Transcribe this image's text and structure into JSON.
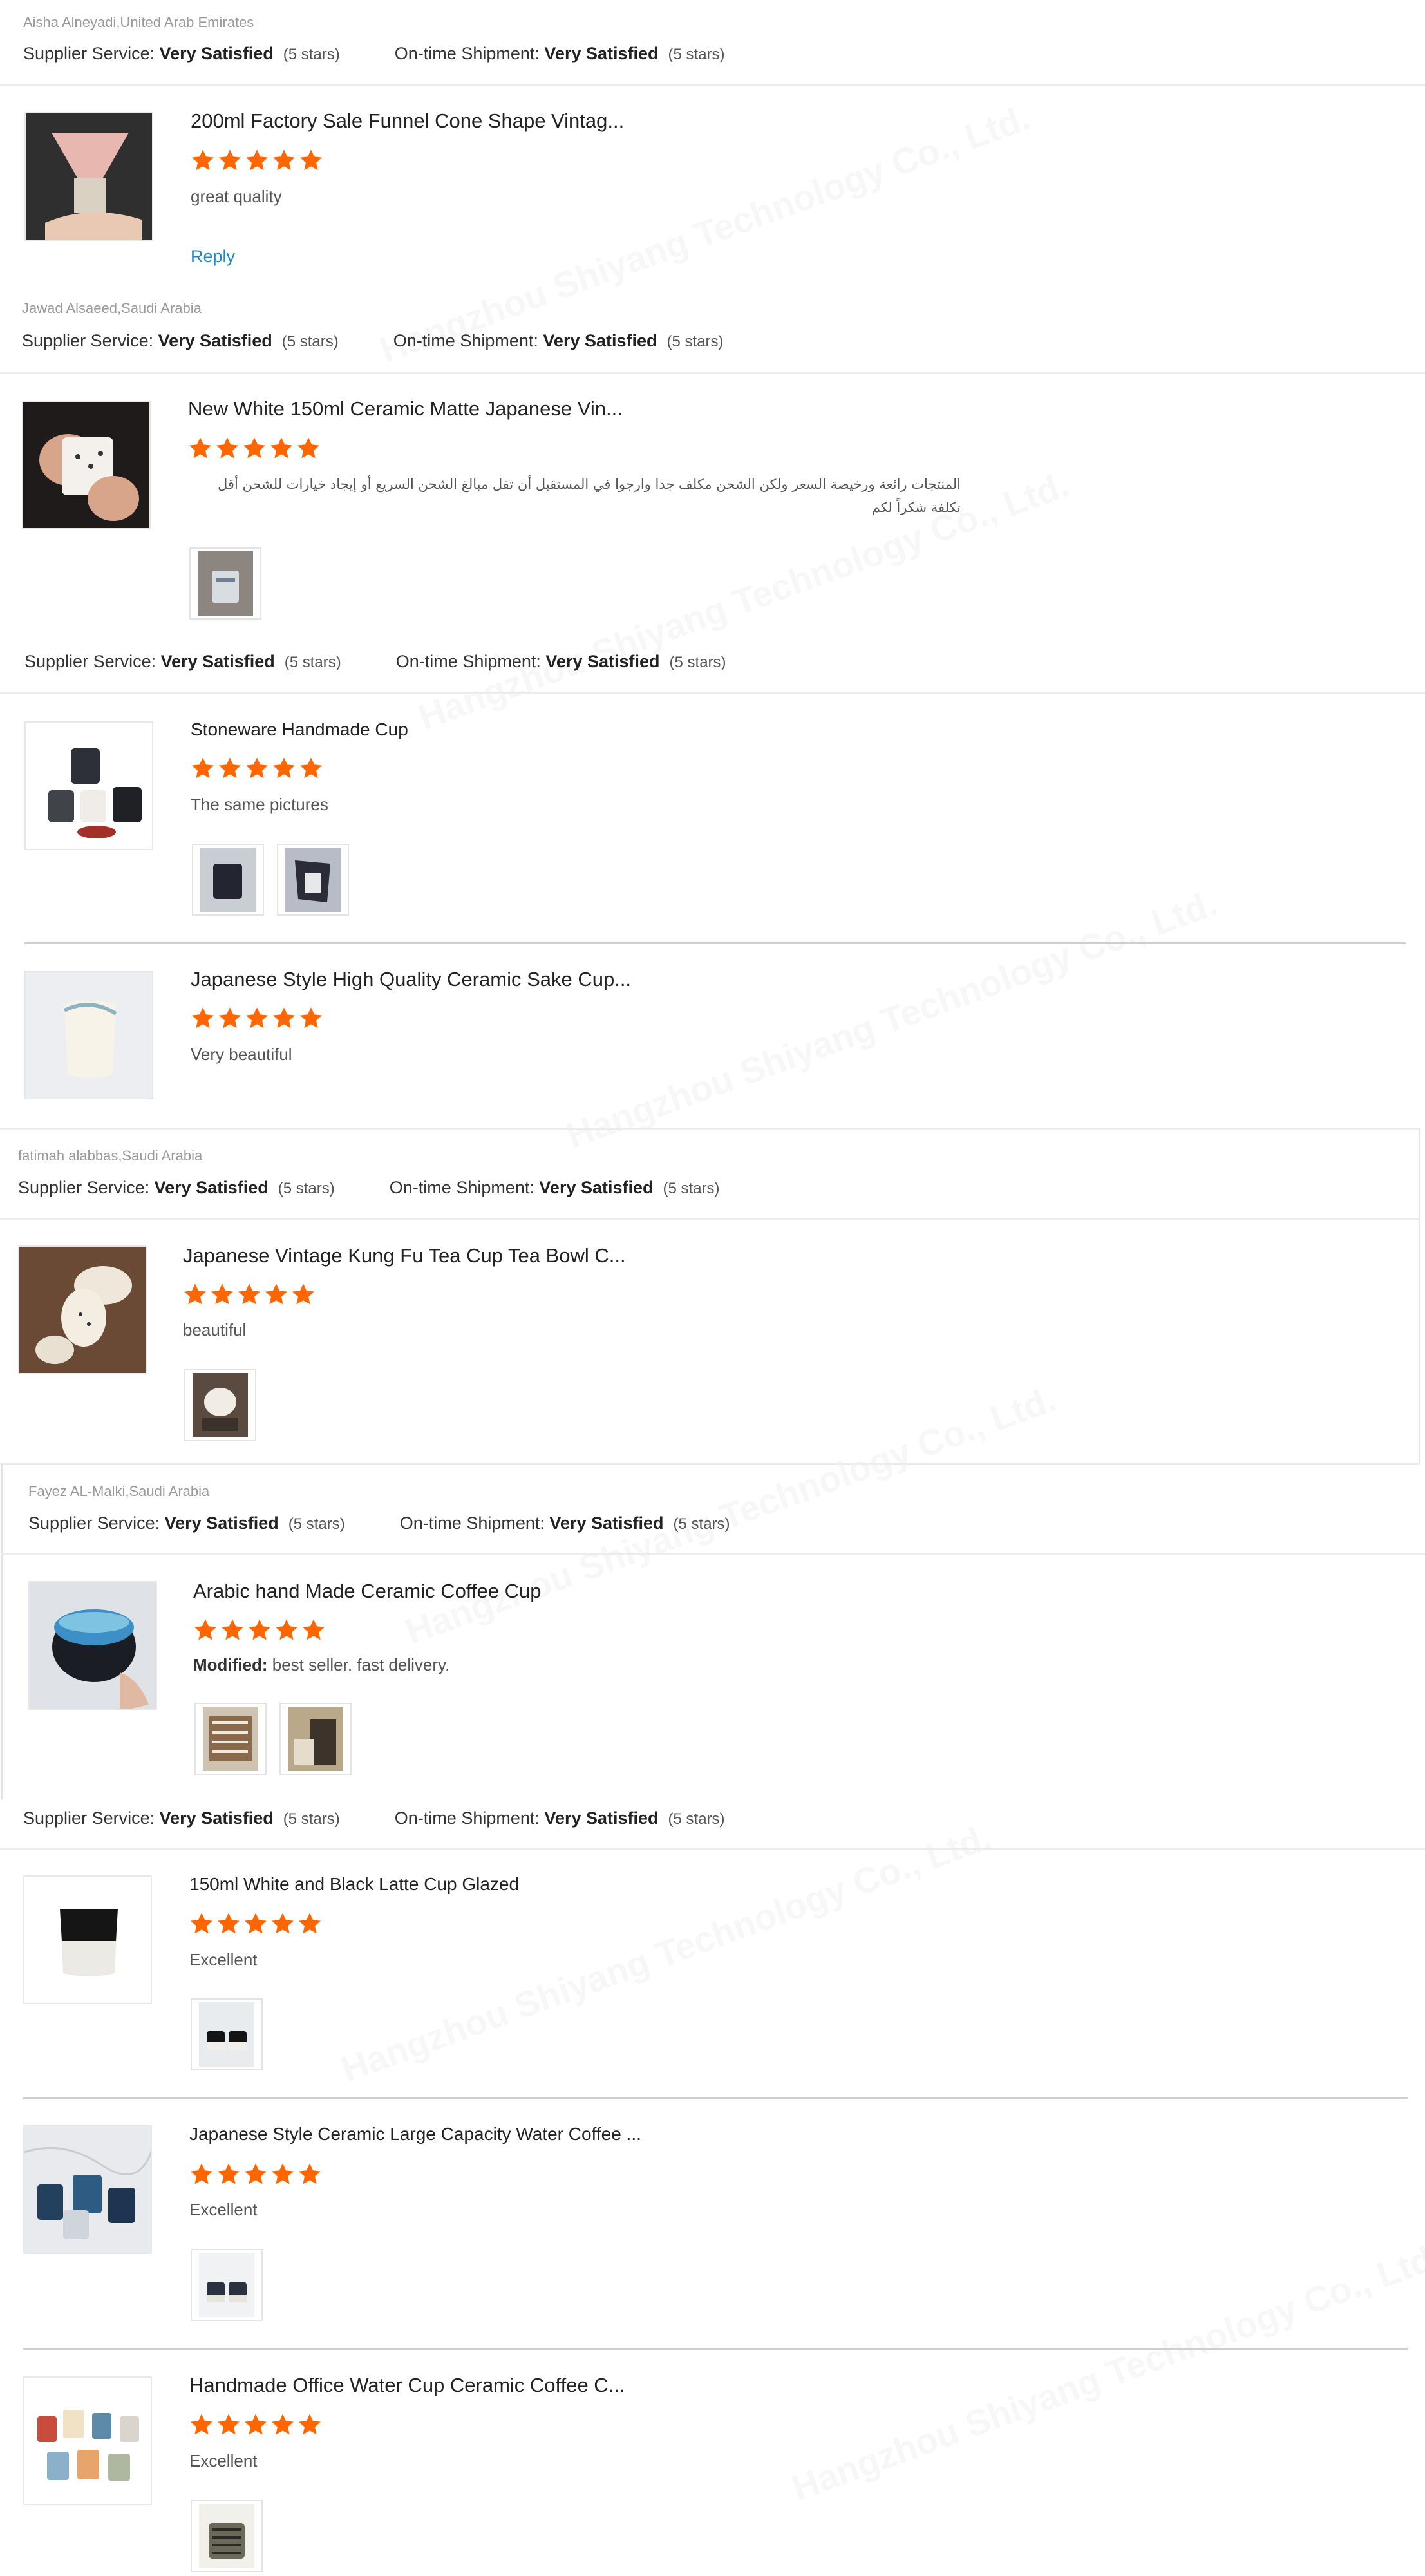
{
  "labels": {
    "supplier_service": "Supplier Service:",
    "ontime_shipment": "On-time Shipment:",
    "very_satisfied": "Very Satisfied",
    "five_stars": "(5 stars)",
    "reply": "Reply",
    "modified": "Modified:"
  },
  "watermark_text": "Hangzhou Shiyang Technology Co., Ltd.",
  "colors": {
    "star": "#ff6600",
    "link": "#1e88c7"
  },
  "reviews": [
    {
      "reviewer": "Aisha Alneyadi,United Arab Emirates",
      "products": [
        {
          "title": "200ml Factory Sale Funnel Cone Shape Vintag...",
          "rating": 5,
          "comment": "great quality",
          "thumb_icon": "pink-funnel-cup-photo"
        }
      ]
    },
    {
      "reviewer": "Jawad Alsaeed,Saudi Arabia",
      "products": [
        {
          "title": "New White 150ml Ceramic Matte Japanese Vin...",
          "rating": 5,
          "comment": "المنتجات رائعة ورخيصة السعر ولكن الشحن مكلف جدا وارجوا في المستقبل أن تقل مبالغ الشحن السريع أو إيجاد خيارات للشحن أقل تكلفة شكراً لكم",
          "thumb_icon": "white-cup-photo"
        }
      ]
    },
    {
      "reviewer": "",
      "products": [
        {
          "title": "Stoneware Handmade Cup",
          "rating": 5,
          "comment": "The same pictures",
          "thumb_icon": "stoneware-cups-photo"
        },
        {
          "title": "Japanese Style High Quality Ceramic Sake Cup...",
          "rating": 5,
          "comment": "Very beautiful",
          "thumb_icon": "sake-cup-photo"
        }
      ]
    },
    {
      "reviewer": "fatimah alabbas,Saudi Arabia",
      "products": [
        {
          "title": "Japanese Vintage Kung Fu Tea Cup Tea Bowl C...",
          "rating": 5,
          "comment": "beautiful",
          "thumb_icon": "kung-fu-tea-cup-photo"
        }
      ]
    },
    {
      "reviewer": "Fayez AL-Malki,Saudi Arabia",
      "products": [
        {
          "title": "Arabic hand Made Ceramic Coffee Cup",
          "rating": 5,
          "comment": "best seller. fast delivery.",
          "thumb_icon": "blue-glaze-coffee-cup-photo"
        }
      ]
    },
    {
      "reviewer": "",
      "products": [
        {
          "title": "150ml White and Black Latte Cup Glazed",
          "rating": 5,
          "comment": "Excellent",
          "thumb_icon": "black-white-latte-cup-photo"
        },
        {
          "title": "Japanese Style Ceramic Large Capacity Water Coffee ...",
          "rating": 5,
          "comment": "Excellent",
          "thumb_icon": "blue-cups-marble-photo"
        },
        {
          "title": "Handmade Office Water Cup Ceramic Coffee C...",
          "rating": 5,
          "comment": "Excellent",
          "thumb_icon": "colorful-cups-photo"
        }
      ]
    }
  ]
}
